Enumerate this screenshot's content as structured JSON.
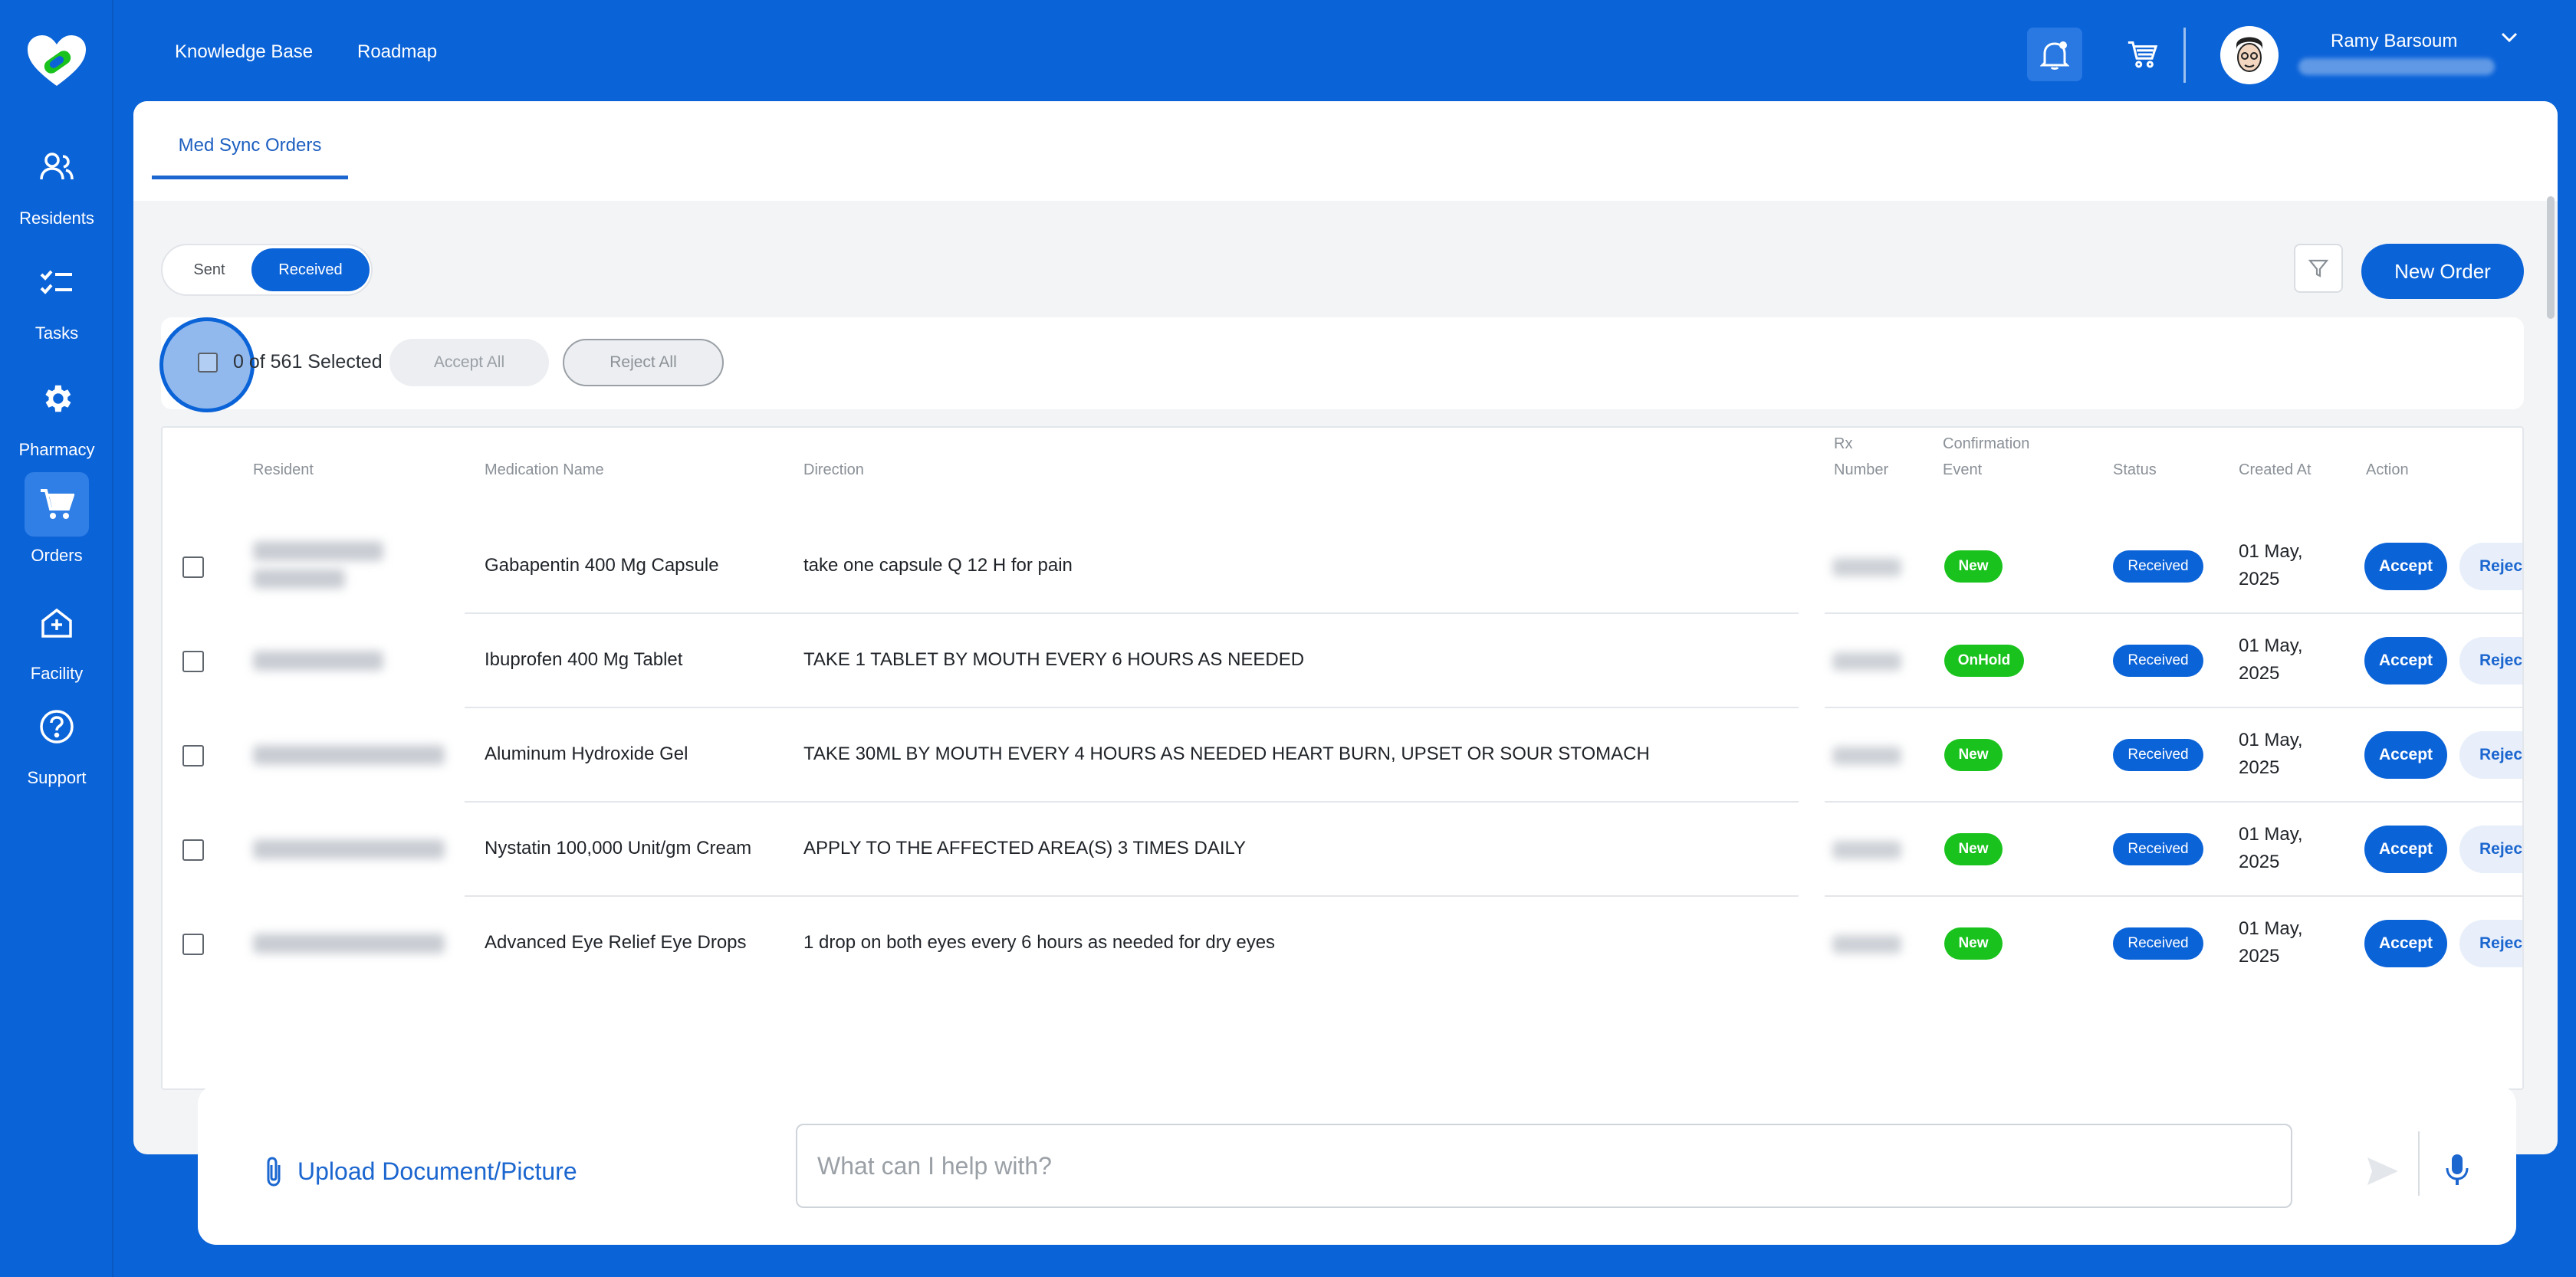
{
  "nav": {
    "links": [
      "Knowledge Base",
      "Roadmap"
    ],
    "items": [
      {
        "label": "Residents",
        "icon": "residents-icon"
      },
      {
        "label": "Tasks",
        "icon": "tasks-icon"
      },
      {
        "label": "Pharmacy",
        "icon": "gear-icon"
      },
      {
        "label": "Orders",
        "icon": "cart-icon",
        "active": true
      },
      {
        "label": "Facility",
        "icon": "facility-icon"
      },
      {
        "label": "Support",
        "icon": "help-icon"
      }
    ]
  },
  "user": {
    "name": "Ramy Barsoum"
  },
  "tabs": [
    "Med Sync Orders"
  ],
  "toggle": {
    "sent": "Sent",
    "received": "Received",
    "selected": "Received"
  },
  "toolbar": {
    "new_order": "New Order"
  },
  "selection": {
    "text": "0 of 561 Selected",
    "accept_all": "Accept All",
    "reject_all": "Reject All"
  },
  "table": {
    "headers": {
      "resident": "Resident",
      "medication": "Medication Name",
      "direction": "Direction",
      "rx_1": "Rx",
      "rx_2": "Number",
      "conf_1": "Confirmation",
      "conf_2": "Event",
      "status": "Status",
      "created": "Created At",
      "action": "Action"
    },
    "rows": [
      {
        "medication": "Gabapentin 400 Mg Capsule",
        "direction": "take one capsule Q 12 H for pain",
        "event": "New",
        "status": "Received",
        "date_1": "01 May,",
        "date_2": "2025",
        "accept": "Accept",
        "reject": "Reject"
      },
      {
        "medication": "Ibuprofen 400 Mg Tablet",
        "direction": "TAKE 1 TABLET BY MOUTH EVERY 6 HOURS AS NEEDED",
        "event": "OnHold",
        "status": "Received",
        "date_1": "01 May,",
        "date_2": "2025",
        "accept": "Accept",
        "reject": "Reject"
      },
      {
        "medication": "Aluminum Hydroxide Gel",
        "direction": "TAKE 30ML BY MOUTH EVERY 4 HOURS AS NEEDED HEART BURN, UPSET OR SOUR STOMACH",
        "event": "New",
        "status": "Received",
        "date_1": "01 May,",
        "date_2": "2025",
        "accept": "Accept",
        "reject": "Reject"
      },
      {
        "medication": "Nystatin 100,000 Unit/gm Cream",
        "direction": "APPLY TO THE AFFECTED AREA(S) 3 TIMES DAILY",
        "event": "New",
        "status": "Received",
        "date_1": "01 May,",
        "date_2": "2025",
        "accept": "Accept",
        "reject": "Reject"
      },
      {
        "medication": "Advanced Eye Relief Eye Drops",
        "direction": "1 drop on both eyes every 6 hours as needed for dry eyes",
        "event": "New",
        "status": "Received",
        "date_1": "01 May,",
        "date_2": "2025",
        "accept": "Accept",
        "reject": "Reject"
      }
    ]
  },
  "assistant": {
    "upload_label": "Upload Document/Picture",
    "placeholder": "What can I help with?"
  },
  "colors": {
    "brand": "#0b63d8",
    "event_green": "#19c21c"
  }
}
